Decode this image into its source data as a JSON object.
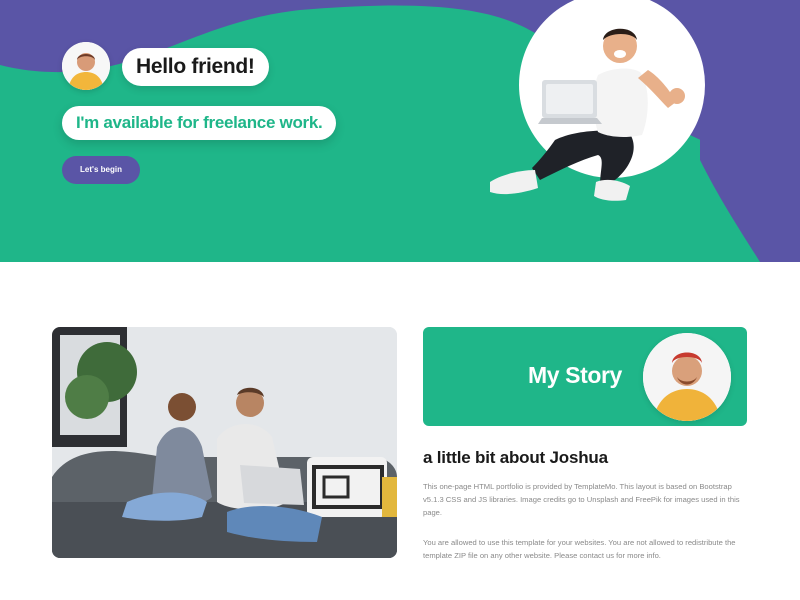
{
  "hero": {
    "greeting": "Hello friend!",
    "tagline": "I'm available for freelance work.",
    "cta_label": "Let's begin"
  },
  "about": {
    "card_title": "My Story",
    "heading": "a little bit about Joshua",
    "paragraph_1": "This one-page HTML portfolio is provided by TemplateMo. This layout is based on Bootstrap v5.1.3 CSS and JS libraries. Image credits go to Unsplash and FreePik for images used in this page.",
    "paragraph_2": "You are allowed to use this template for your websites. You are not allowed to redistribute the template ZIP file on any other website. Please contact us for more info."
  },
  "colors": {
    "green": "#1fb689",
    "purple": "#5a55a6",
    "white": "#ffffff"
  },
  "icons": [
    "avatar-icon",
    "laptop-icon"
  ]
}
